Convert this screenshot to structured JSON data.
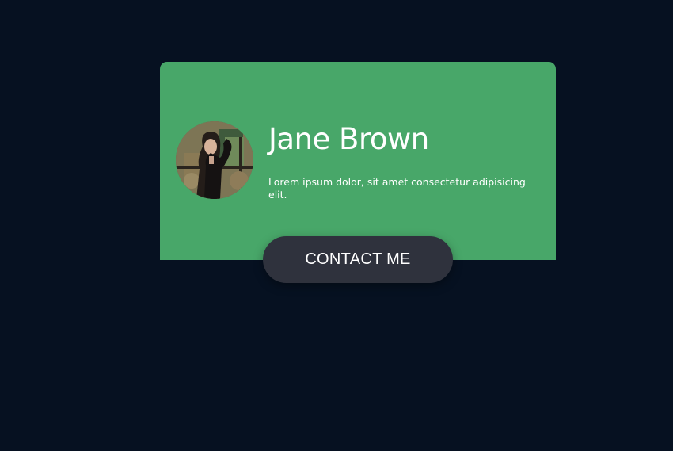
{
  "profile": {
    "name": "Jane Brown",
    "bio": "Lorem ipsum dolor, sit amet consectetur adipisicing elit.",
    "contact_label": "CONTACT ME"
  },
  "colors": {
    "background": "#061121",
    "card": "#48a769",
    "button": "#2f323d",
    "text": "#ffffff"
  }
}
